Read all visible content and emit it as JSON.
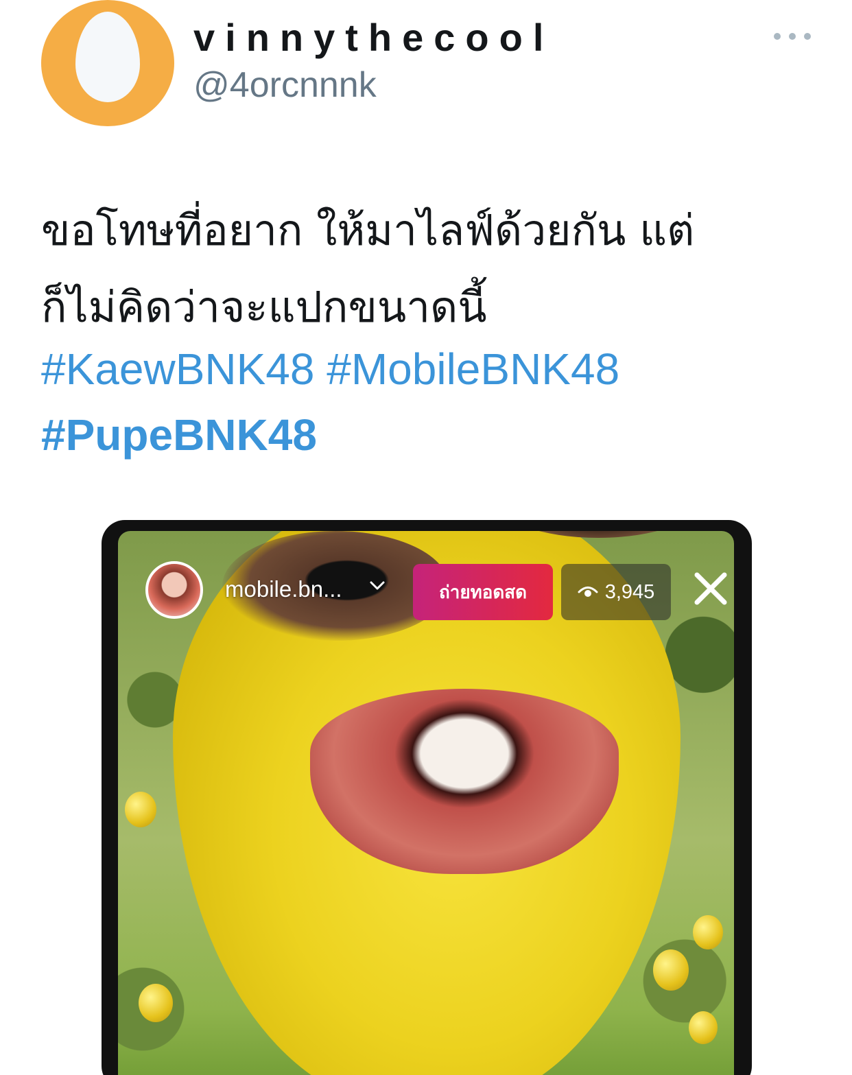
{
  "user": {
    "display_name": "vinnythecool",
    "handle": "@4orcnnnk"
  },
  "tweet": {
    "text_line1": "ขอโทษที่อยาก ให้มาไลฟ์ด้วยกัน แต่",
    "text_line2": "ก็ไม่คิดว่าจะแปกขนาดนี้",
    "hashtags": [
      "#KaewBNK48",
      "#MobileBNK48",
      "#PupeBNK48"
    ]
  },
  "media": {
    "live_username": "mobile.bn...",
    "live_label": "ถ่ายทอดสด",
    "viewer_count": "3,945"
  },
  "colors": {
    "link": "#3b94d9",
    "avatar_bg": "#f5ad45",
    "live_badge": "#e3293f"
  },
  "icons": [
    "more-icon",
    "chevron-down-icon",
    "eye-icon",
    "close-icon"
  ]
}
